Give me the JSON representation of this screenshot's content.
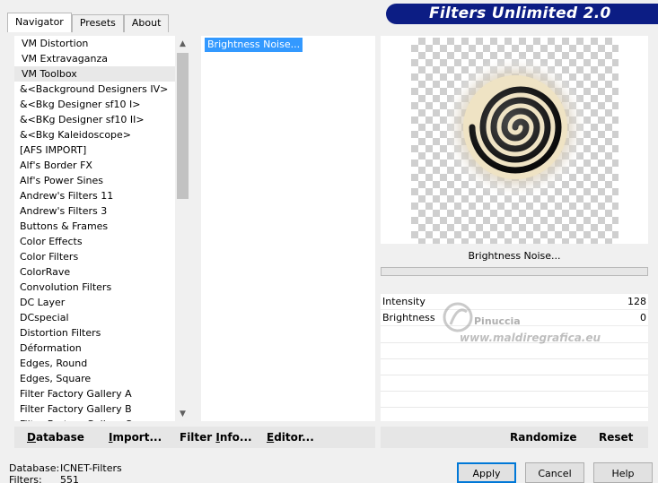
{
  "title_banner": "Filters Unlimited 2.0",
  "tabs": [
    {
      "label": "Navigator"
    },
    {
      "label": "Presets"
    },
    {
      "label": "About"
    }
  ],
  "categories": [
    "VM Distortion",
    "VM Extravaganza",
    "VM Toolbox",
    "&<Background Designers IV>",
    "&<Bkg Designer sf10 I>",
    "&<BKg Designer sf10 II>",
    "&<Bkg Kaleidoscope>",
    "[AFS IMPORT]",
    "Alf's Border FX",
    "Alf's Power Sines",
    "Andrew's Filters 11",
    "Andrew's Filters 3",
    "Buttons & Frames",
    "Color Effects",
    "Color Filters",
    "ColorRave",
    "Convolution Filters",
    "DC Layer",
    "DCspecial",
    "Distortion Filters",
    "Déformation",
    "Edges, Round",
    "Edges, Square",
    "Filter Factory Gallery A",
    "Filter Factory Gallery B",
    "Filter Factory Gallery C"
  ],
  "selected_category": "VM Toolbox",
  "filters": [
    "Brightness Noise..."
  ],
  "selected_filter": "Brightness Noise...",
  "preview": {
    "filter_name": "Brightness Noise..."
  },
  "params": [
    {
      "name": "Intensity",
      "value": "128"
    },
    {
      "name": "Brightness",
      "value": "0"
    }
  ],
  "watermark": {
    "name": "Pinuccia",
    "url": "www.maldiregrafica.eu"
  },
  "left_buttons": {
    "database": {
      "u": "D",
      "rest": "atabase"
    },
    "import": {
      "u": "I",
      "rest": "mport..."
    },
    "filter_info": {
      "pre": "Filter ",
      "u": "I",
      "rest": "nfo..."
    },
    "editor": {
      "u": "E",
      "rest": "ditor..."
    }
  },
  "right_buttons": {
    "randomize": "Randomize",
    "reset": "Reset"
  },
  "status": {
    "database_label": "Database:",
    "database_value": "ICNET-Filters",
    "filters_label": "Filters:",
    "filters_value": "551"
  },
  "dialog_buttons": {
    "apply": "Apply",
    "cancel": "Cancel",
    "help": "Help"
  },
  "colors": {
    "banner": "#0c1d84",
    "selection": "#3399ff",
    "default_button_border": "#0078d7"
  }
}
